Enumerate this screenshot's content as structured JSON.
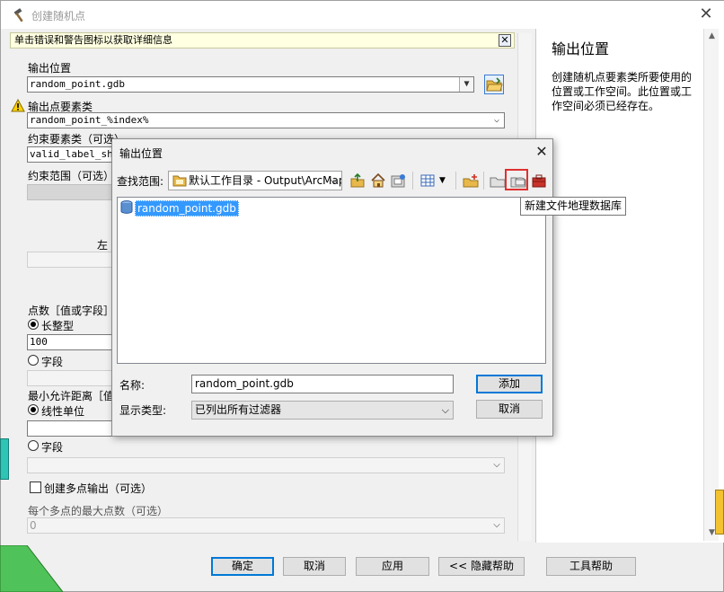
{
  "main": {
    "title": "创建随机点",
    "hint": "单击错误和警告图标以获取详细信息",
    "close_symbol": "✕"
  },
  "form": {
    "output_location_label": "输出位置",
    "output_location_value": "random_point.gdb",
    "output_fc_label": "输出点要素类",
    "output_fc_value": "random_point_%index%",
    "constraint_fc_label": "约束要素类（可选）",
    "constraint_fc_value": "valid_label_shap",
    "constraint_extent_label": "约束范围（可选）",
    "left_label": "左",
    "count_label": "点数［值或字段］",
    "long_label": "长整型",
    "count_value": "100",
    "field_label": "字段",
    "min_distance_label": "最小允许距离［值",
    "linear_unit_label": "线性单位",
    "field2_label": "字段",
    "multipoint_label": "创建多点输出（可选）",
    "max_points_label": "每个多点的最大点数（可选）",
    "max_points_value": "0"
  },
  "help": {
    "title": "输出位置",
    "text": "创建随机点要素类所要使用的位置或工作空间。此位置或工作空间必须已经存在。"
  },
  "buttons": {
    "ok": "确定",
    "cancel": "取消",
    "apply": "应用",
    "hide_help": "<< 隐藏帮助",
    "tool_help": "工具帮助"
  },
  "dialog": {
    "title": "输出位置",
    "look_in_label": "查找范围:",
    "look_in_value": "默认工作目录 - Output\\ArcMap",
    "items": [
      {
        "name": "random_point.gdb",
        "selected": true
      }
    ],
    "name_label": "名称:",
    "name_value": "random_point.gdb",
    "type_label": "显示类型:",
    "type_value": "已列出所有过滤器",
    "add_label": "添加",
    "cancel_label": "取消"
  },
  "tooltip": {
    "text": "新建文件地理数据库"
  },
  "background_leak": {
    "side_text": "le\nle\n",
    "bottom_left_text": "ic\nar\nma\nndex%"
  },
  "colors": {
    "accent": "#0078d7",
    "selection": "#3399ff",
    "highlight_box": "#e03030",
    "hint_bg": "#ffffe1"
  }
}
